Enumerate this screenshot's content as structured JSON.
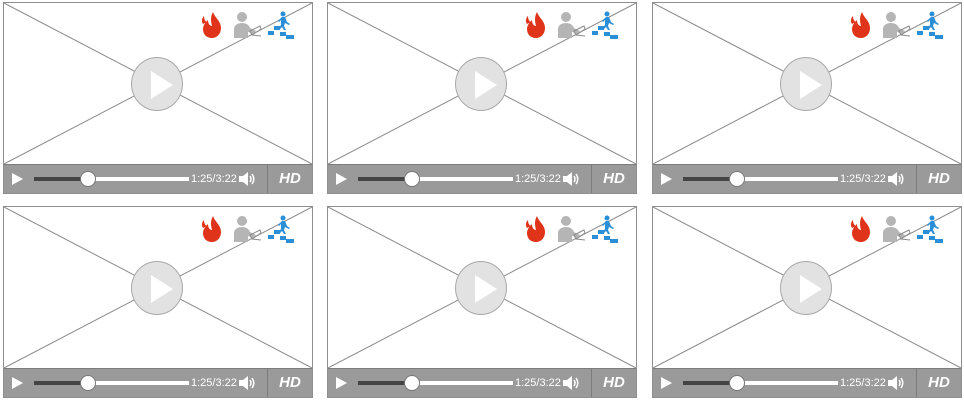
{
  "players": [
    {
      "time_label": "1:25/3:22",
      "hd_label": "HD",
      "progress": 0.35
    },
    {
      "time_label": "1:25/3:22",
      "hd_label": "HD",
      "progress": 0.35
    },
    {
      "time_label": "1:25/3:22",
      "hd_label": "HD",
      "progress": 0.35
    },
    {
      "time_label": "1:25/3:22",
      "hd_label": "HD",
      "progress": 0.35
    },
    {
      "time_label": "1:25/3:22",
      "hd_label": "HD",
      "progress": 0.35
    },
    {
      "time_label": "1:25/3:22",
      "hd_label": "HD",
      "progress": 0.35
    }
  ],
  "icons": {
    "play": "play-icon",
    "volume": "volume-icon",
    "fire": "fire-icon",
    "reader": "person-reading-icon",
    "stairs": "stairs-climber-icon"
  },
  "colors": {
    "control_bar": "#9a9a9a",
    "border": "#8f8f8f",
    "fire": "#e0341a",
    "reader": "#b5b5b5",
    "stairs": "#2a8fd6",
    "progress_fill": "#444444"
  }
}
